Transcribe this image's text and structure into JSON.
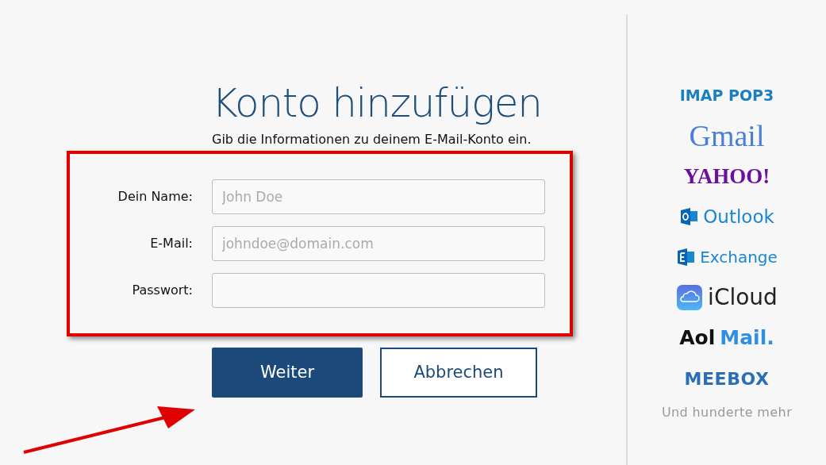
{
  "title": "Konto hinzufügen",
  "description": "Gib die Informationen zu deinem E-Mail-Konto ein.",
  "fields": [
    {
      "label": "Dein Name:",
      "placeholder": "John Doe"
    },
    {
      "label": "E-Mail:",
      "placeholder": "johndoe@domain.com"
    },
    {
      "label": "Passwort:"
    }
  ],
  "buttons": [
    {
      "label": "Weiter",
      "kind": "primary"
    },
    {
      "label": "Abbrechen",
      "kind": "secondary"
    }
  ],
  "providers": [
    {
      "kind": "plain",
      "parts": [
        {
          "text": "IMAP POP3",
          "color": "#1a7fc1"
        }
      ]
    },
    {
      "kind": "gmail",
      "parts": [
        {
          "text": "Gmail",
          "color": "#4a7fd8"
        }
      ]
    },
    {
      "kind": "yahoo",
      "parts": [
        {
          "text": "YAHOO!",
          "color": "#6b0f9c"
        }
      ]
    },
    {
      "kind": "outlook",
      "parts": [
        {
          "text": "Outlook",
          "color": "#1b86d0"
        }
      ]
    },
    {
      "kind": "exchange",
      "parts": [
        {
          "text": "Exchange",
          "color": "#1b86d0"
        }
      ]
    },
    {
      "kind": "icloud",
      "parts": [
        {
          "text": "iCloud",
          "color": "#222222"
        }
      ]
    },
    {
      "kind": "aol",
      "parts": [
        {
          "text": "Aol",
          "color": "#111111"
        },
        {
          "text": "Mail.",
          "color": "#2f8fe0"
        }
      ]
    },
    {
      "kind": "meebox",
      "parts": [
        {
          "text": "MEEBOX",
          "color": "#2a6fb5"
        }
      ]
    }
  ],
  "providers_note": "Und hunderte mehr"
}
